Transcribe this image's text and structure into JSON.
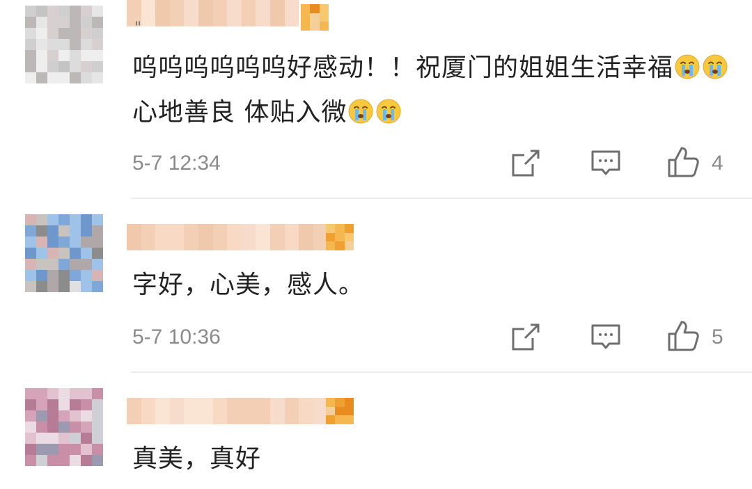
{
  "comments": [
    {
      "text": "呜呜呜呜呜呜好感动！！祝厦门的姐姐生活幸福",
      "text_after_emoji": "心地善良 体贴入微",
      "time": "5-7 12:34",
      "likes": "4",
      "quote_mark": "\""
    },
    {
      "text": "字好，心美，感人。",
      "time": "5-7 10:36",
      "likes": "5"
    },
    {
      "text": "真美，真好"
    }
  ],
  "icons": {
    "share": "share-icon",
    "reply": "comment-icon",
    "like": "thumbs-up-icon",
    "emoji": "crying-face-icon"
  },
  "colors": {
    "text": "#222222",
    "meta": "#8a8a8a",
    "icon": "#6e6e6e",
    "divider": "#ececec"
  }
}
